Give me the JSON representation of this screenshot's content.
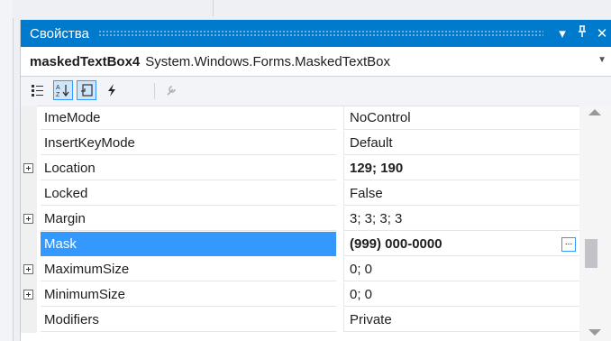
{
  "window": {
    "title": "Свойства"
  },
  "title_controls": {
    "dropdown_icon": "▾",
    "pin_icon": "ᵖ",
    "close_icon": "✕"
  },
  "object_selector": {
    "name": "maskedTextBox4",
    "type": "System.Windows.Forms.MaskedTextBox"
  },
  "toolbar": {
    "buttons": [
      "categorized-icon",
      "alphabetical-icon",
      "properties-icon",
      "events-icon",
      "property-pages-icon"
    ],
    "active": [
      "alphabetical-icon",
      "properties-icon"
    ]
  },
  "properties": [
    {
      "name": "ImeMode",
      "value": "NoControl",
      "expandable": false,
      "bold": false
    },
    {
      "name": "InsertKeyMode",
      "value": "Default",
      "expandable": false,
      "bold": false
    },
    {
      "name": "Location",
      "value": "129; 190",
      "expandable": true,
      "bold": true
    },
    {
      "name": "Locked",
      "value": "False",
      "expandable": false,
      "bold": false
    },
    {
      "name": "Margin",
      "value": "3; 3; 3; 3",
      "expandable": true,
      "bold": false
    },
    {
      "name": "Mask",
      "value": "(999) 000-0000",
      "expandable": false,
      "bold": true,
      "selected": true,
      "ellipsis": "..."
    },
    {
      "name": "MaximumSize",
      "value": "0; 0",
      "expandable": true,
      "bold": false
    },
    {
      "name": "MinimumSize",
      "value": "0; 0",
      "expandable": true,
      "bold": false
    },
    {
      "name": "Modifiers",
      "value": "Private",
      "expandable": false,
      "bold": false
    }
  ],
  "colors": {
    "titlebar": "#007acc",
    "selection": "#3399ff",
    "accent_border": "#3399ff"
  }
}
